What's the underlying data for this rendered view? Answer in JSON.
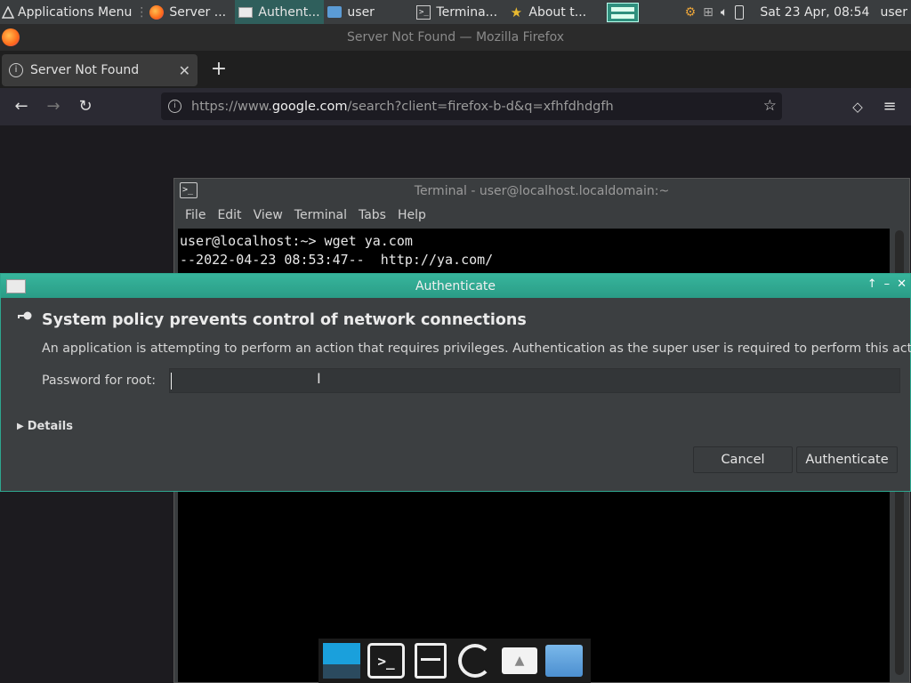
{
  "panel": {
    "apps_menu": "Applications Menu",
    "tasks": [
      {
        "label": "Server ...",
        "icon": "firefox-icon"
      },
      {
        "label": "Authent...",
        "icon": "window-icon"
      },
      {
        "label": "user",
        "icon": "home-folder-icon"
      },
      {
        "label": "Termina...",
        "icon": "terminal-icon"
      },
      {
        "label": "About t...",
        "icon": "star-icon"
      }
    ],
    "clock": "Sat 23 Apr, 08:54",
    "user": "user"
  },
  "firefox": {
    "window_title": "Server Not Found — Mozilla Firefox",
    "tab_title": "Server Not Found",
    "url_prefix": "https://www.",
    "url_domain": "google.com",
    "url_rest": "/search?client=firefox-b-d&q=xfhfdhdgfh"
  },
  "terminal": {
    "title": "Terminal - user@localhost.localdomain:~",
    "menu": [
      "File",
      "Edit",
      "View",
      "Terminal",
      "Tabs",
      "Help"
    ],
    "lines": [
      "user@localhost:~> wget ya.com",
      "--2022-04-23 08:53:47--  http://ya.com/"
    ]
  },
  "dialog": {
    "title": "Authenticate",
    "heading": "System policy prevents control of network connections",
    "description": "An application is attempting to perform an action that requires privileges. Authentication as the super user is required to perform this action.",
    "password_label": "Password for root:",
    "password_value": "",
    "details_label": "Details",
    "cancel_label": "Cancel",
    "authenticate_label": "Authenticate"
  },
  "colors": {
    "dialog_title_bar": "#2ea78f",
    "panel_bg": "#3a3d3f",
    "terminal_bg": "#000000"
  }
}
